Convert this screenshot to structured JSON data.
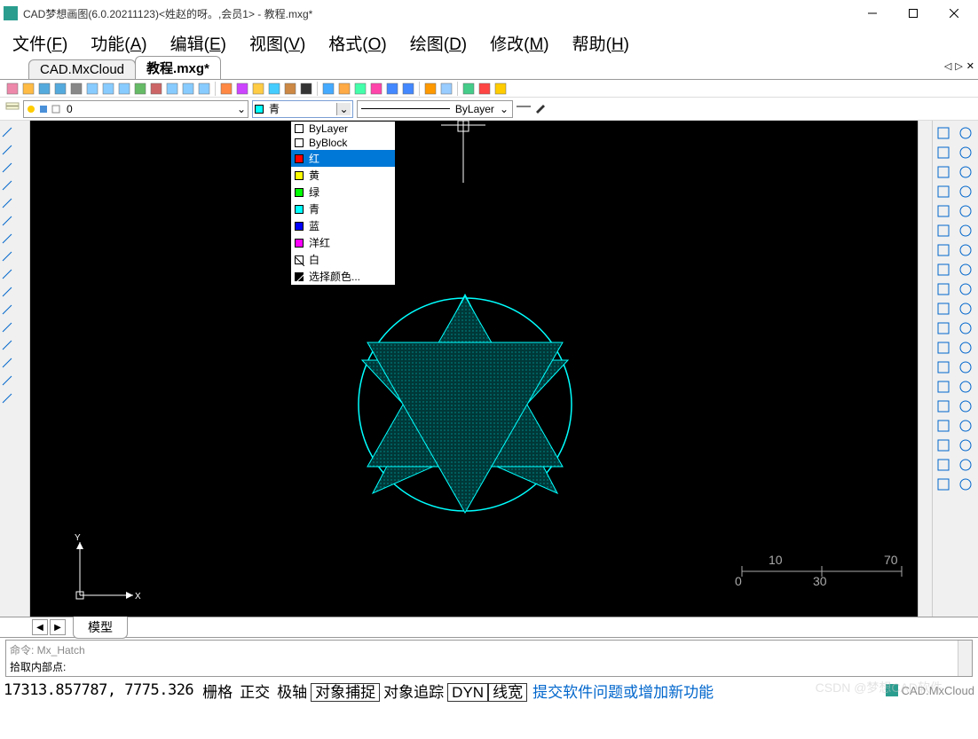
{
  "titlebar": {
    "title": "CAD梦想画图(6.0.20211123)<姓赵的呀。,会员1> - 教程.mxg*"
  },
  "menubar": {
    "items": [
      {
        "label": "文件",
        "key": "F"
      },
      {
        "label": "功能",
        "key": "A"
      },
      {
        "label": "编辑",
        "key": "E"
      },
      {
        "label": "视图",
        "key": "V"
      },
      {
        "label": "格式",
        "key": "O"
      },
      {
        "label": "绘图",
        "key": "D"
      },
      {
        "label": "修改",
        "key": "M"
      },
      {
        "label": "帮助",
        "key": "H"
      }
    ]
  },
  "tabs": {
    "items": [
      {
        "label": "CAD.MxCloud",
        "active": false
      },
      {
        "label": "教程.mxg*",
        "active": true
      }
    ]
  },
  "layer_dropdown": {
    "value": "0"
  },
  "color_dropdown": {
    "value": "青",
    "swatch": "#00ffff",
    "options": [
      {
        "label": "ByLayer",
        "color": "#ffffff"
      },
      {
        "label": "ByBlock",
        "color": "#ffffff"
      },
      {
        "label": "红",
        "color": "#ff0000",
        "selected": true
      },
      {
        "label": "黄",
        "color": "#ffff00"
      },
      {
        "label": "绿",
        "color": "#00ff00"
      },
      {
        "label": "青",
        "color": "#00ffff"
      },
      {
        "label": "蓝",
        "color": "#0000ff"
      },
      {
        "label": "洋红",
        "color": "#ff00ff"
      },
      {
        "label": "白",
        "color": "#ffffff"
      },
      {
        "label": "选择颜色...",
        "color": "#000000"
      }
    ]
  },
  "linetype_dropdown": {
    "value": "ByLayer"
  },
  "model_tab": {
    "label": "模型"
  },
  "cmdline": {
    "line1": "命令: Mx_Hatch",
    "line2": "拾取内部点:"
  },
  "statusbar": {
    "coords": "17313.857787, 7775.326",
    "buttons": [
      {
        "label": "栅格",
        "boxed": false
      },
      {
        "label": "正交",
        "boxed": false
      },
      {
        "label": "极轴",
        "boxed": false
      },
      {
        "label": "对象捕捉",
        "boxed": true
      },
      {
        "label": "对象追踪",
        "boxed": false
      },
      {
        "label": "DYN",
        "boxed": true
      },
      {
        "label": "线宽",
        "boxed": true
      }
    ],
    "link": "提交软件问题或增加新功能",
    "brand": "CAD.MxCloud"
  },
  "scalebar": {
    "left": "10",
    "right": "70",
    "mid": "30",
    "zero": "0"
  },
  "axis": {
    "x": "X",
    "y": "Y"
  },
  "watermark": "CSDN @梦想CAD软件"
}
